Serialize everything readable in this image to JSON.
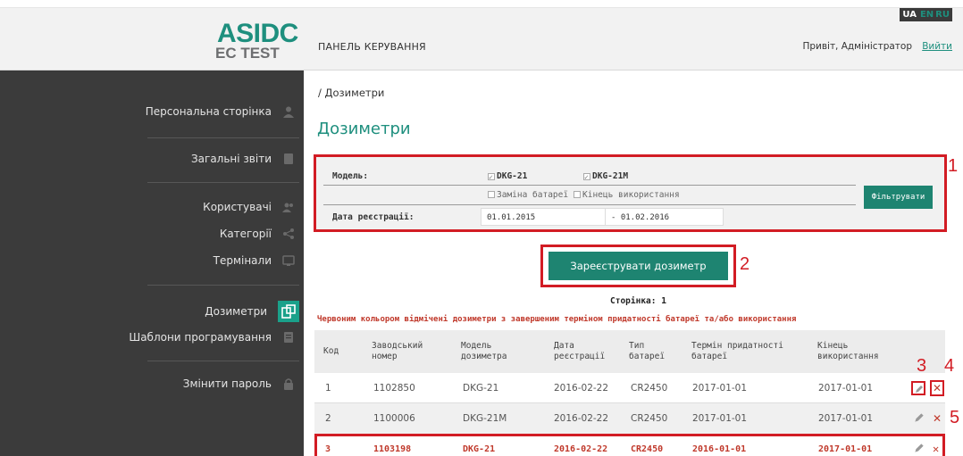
{
  "header": {
    "logo_line1": "ASIDC",
    "logo_line2": "EC TEST",
    "panel_title": "ПАНЕЛЬ КЕРУВАННЯ",
    "greeting": "Привіт, Адміністратор",
    "logout": "Вийти",
    "languages": [
      "UA",
      "EN",
      "RU"
    ],
    "active_language": "UA"
  },
  "sidebar": {
    "items": [
      {
        "label": "Персональна сторінка",
        "icon": "user-icon"
      },
      {
        "label": "Загальні звіти",
        "icon": "report-icon"
      },
      {
        "label": "Користувачі",
        "icon": "users-icon"
      },
      {
        "label": "Категорії",
        "icon": "share-icon"
      },
      {
        "label": "Термінали",
        "icon": "monitor-icon"
      },
      {
        "label": "Дозиметри",
        "icon": "dosimeter-icon",
        "active": true
      },
      {
        "label": "Шаблони програмування",
        "icon": "template-icon"
      },
      {
        "label": "Змінити пароль",
        "icon": "lock-icon"
      }
    ]
  },
  "breadcrumb": "/ Дозиметри",
  "page_title": "Дозиметри",
  "filter": {
    "model_label": "Модель:",
    "model_dkg21": "DKG-21",
    "model_dkg21m": "DKG-21M",
    "battery_replace": "Заміна батареї",
    "end_of_use": "Кінець використання",
    "reg_date_label": "Дата реєстрації:",
    "date_from": "01.01.2015",
    "date_sep": "-",
    "date_to": "01.02.2016",
    "filter_button": "Фільтрувати"
  },
  "register_button": "Зареєструвати дозиметр",
  "annotations": [
    "1",
    "2",
    "3",
    "4",
    "5"
  ],
  "page_label": "Сторінка: 1",
  "warning": "Червоним кольором відмічені дозиметри з завершеним терміном придатності батареї та/або використання",
  "table": {
    "headers": [
      "Код",
      "Заводський номер",
      "Модель дозиметра",
      "Дата реєстрації",
      "Тип батареї",
      "Термін придатності батареї",
      "Кінець використання"
    ],
    "rows": [
      [
        "1",
        "1102850",
        "DKG-21",
        "2016-02-22",
        "CR2450",
        "2017-01-01",
        "2017-01-01"
      ],
      [
        "2",
        "1100006",
        "DKG-21M",
        "2016-02-22",
        "CR2450",
        "2017-01-01",
        "2017-01-01"
      ],
      [
        "3",
        "1103198",
        "DKG-21",
        "2016-02-22",
        "CR2450",
        "2016-01-01",
        "2017-01-01"
      ]
    ]
  },
  "colors": {
    "accent": "#1e8f7e",
    "button": "#1e8471",
    "sidebar": "#3b3b3b",
    "highlight": "#d21c24",
    "warning_text": "#c0392b"
  }
}
